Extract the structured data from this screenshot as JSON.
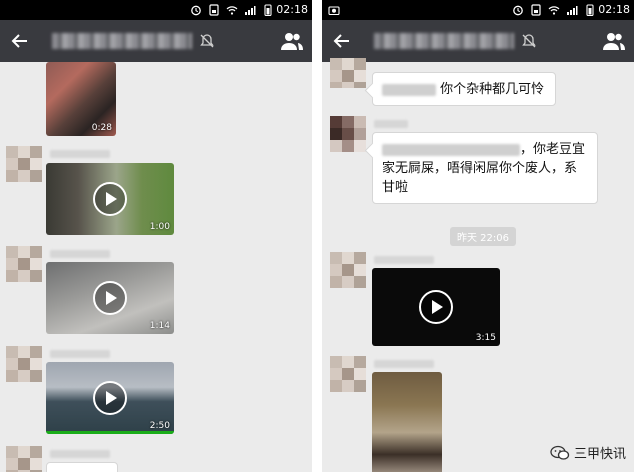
{
  "status_bar": {
    "time": "02:18"
  },
  "left_screen": {
    "videos": [
      {
        "duration": "0:28"
      },
      {
        "duration": "1:00"
      },
      {
        "duration": "1:14"
      },
      {
        "duration": "2:50"
      }
    ]
  },
  "right_screen": {
    "messages": [
      {
        "text": "你个杂种都几可怜"
      },
      {
        "text_line1": "，你老豆宜",
        "text_line2": "家无屙屎，唔得闲屌你个废人，系",
        "text_line3": "甘啦"
      }
    ],
    "timestamp": "昨天 22:06",
    "video": {
      "duration": "3:15"
    }
  },
  "watermark": {
    "text": "三甲快讯"
  },
  "colors": {
    "navbar": "#393a3f",
    "chat_background": "#ebebeb",
    "progress": "#1aad19"
  }
}
